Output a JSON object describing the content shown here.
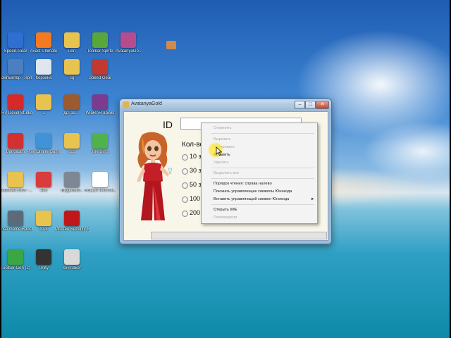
{
  "desktop_icons": [
    {
      "label": "Speed-Gear",
      "name": "speedgear-desktop-icon",
      "color": "#2f6fd1"
    },
    {
      "label": "Avast Ultimate",
      "name": "avast-desktop-icon",
      "color": "#f47a20"
    },
    {
      "label": "ноп",
      "name": "folder-nop-icon",
      "color": "#e9c34f"
    },
    {
      "label": "Toolbar Sprite",
      "name": "toolbar-sprite-icon",
      "color": "#58a63c"
    },
    {
      "label": "AvatanyaGo..",
      "name": "avatanyago-desktop-icon",
      "color": "#b64c8e"
    },
    {
      "label": "Компьютер - Ярлык",
      "name": "computer-shortcut-icon",
      "color": "#4c7fbf"
    },
    {
      "label": "Корзина",
      "name": "recycle-bin-icon",
      "color": "#dfe6ee"
    },
    {
      "label": "sg",
      "name": "folder-sg-icon",
      "color": "#e9c34f"
    },
    {
      "label": "Speed Gear",
      "name": "speed-gear-icon",
      "color": "#c2392f"
    },
    {
      "label": "PHP Devel Studio 2.0",
      "name": "php-devel-studio-icon",
      "color": "#d52a2a"
    },
    {
      "label": "з",
      "name": "folder-z-icon",
      "color": "#e9c34f"
    },
    {
      "label": "дд- за- ..",
      "name": "photo-file-icon",
      "color": "#9b5a2f"
    },
    {
      "label": "WinRAR архив",
      "name": "winrar-archive-icon",
      "color": "#7b3b8f"
    },
    {
      "label": "Bandicam",
      "name": "bandicam-icon",
      "color": "#d23131"
    },
    {
      "label": "Play Online Games.com",
      "name": "play-online-games-icon",
      "color": "#3e94d6"
    },
    {
      "label": "ccc",
      "name": "folder-ccc-icon",
      "color": "#e9c34f"
    },
    {
      "label": "The Sims",
      "name": "the-sims-icon",
      "color": "#4fb34a"
    },
    {
      "label": "Рабочий стол - ..",
      "name": "desktop-folder-icon",
      "color": "#e9c34f"
    },
    {
      "label": "нео",
      "name": "neo-app-icon",
      "color": "#d83c3c"
    },
    {
      "label": "ВидеоMO..",
      "name": "video-mo-icon",
      "color": "#7d8894"
    },
    {
      "label": "Новый текстов..",
      "name": "new-text-document-icon",
      "color": "#ffffff"
    },
    {
      "label": "Wise Game Booster",
      "name": "wise-game-booster-icon",
      "color": "#5c6b7a"
    },
    {
      "label": "ХАК",
      "name": "folder-hak-icon",
      "color": "#e9c34f"
    },
    {
      "label": "McAfee Security Sc..",
      "name": "mcafee-icon",
      "color": "#c01818"
    },
    {
      "label": "Toolbar Gen (2)",
      "name": "toolbar-gen-icon",
      "color": "#3aa744"
    },
    {
      "label": "Unity",
      "name": "unity-icon",
      "color": "#333333"
    },
    {
      "label": "keymaker",
      "name": "keymaker-icon",
      "color": "#d9d9d9"
    }
  ],
  "window": {
    "title": "AvatanyaGold",
    "minimize_glyph": "–",
    "maximize_glyph": "□",
    "close_glyph": "✕",
    "id_label": "ID",
    "id_value": "",
    "count_label": "Кол-во",
    "options": [
      "10 зо",
      "30 зо",
      "50 зо",
      "100 з",
      "200 з"
    ]
  },
  "context_menu": {
    "items": [
      {
        "label": "Отменить",
        "enabled": false
      },
      {
        "label": "Вырезать",
        "enabled": false
      },
      {
        "label": "Копировать",
        "enabled": false
      },
      {
        "label": "Вставить",
        "enabled": true
      },
      {
        "label": "Удалить",
        "enabled": false
      },
      {
        "label": "Выделить все",
        "enabled": false
      },
      {
        "label": "Порядок чтения: справа налево",
        "enabled": true
      },
      {
        "label": "Показать управляющие символы Юникода",
        "enabled": true
      },
      {
        "label": "Вставить управляющий символ Юникода",
        "enabled": true,
        "submenu_arrow": "►"
      },
      {
        "label": "Открыть IME",
        "enabled": true
      },
      {
        "label": "Реконверсия",
        "enabled": false
      }
    ]
  },
  "colors": {
    "window_frame": "#9dbcd9",
    "client_bg": "#f8f5e9",
    "close_button": "#c4432b",
    "highlight": "#ffe100"
  }
}
